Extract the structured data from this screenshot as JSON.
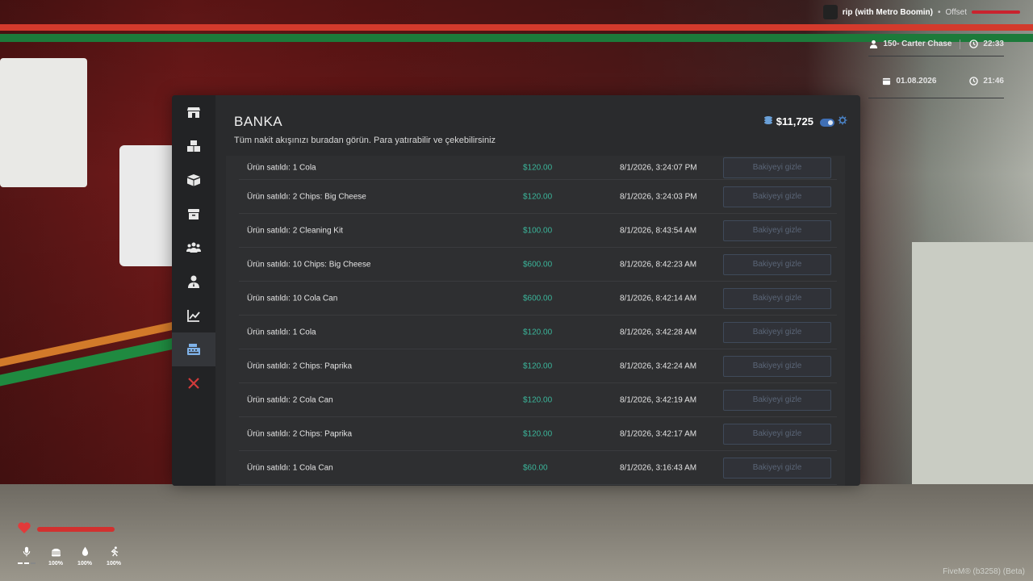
{
  "hud": {
    "music": {
      "track": "rip (with Metro Boomin)",
      "artist": "Offset"
    },
    "player": {
      "id_name": "150- Carter Chase",
      "time": "22:33"
    },
    "game": {
      "date": "01.08.2026",
      "clock": "21:46"
    },
    "vitals": {
      "hunger": "100%",
      "thirst": "100%",
      "stamina": "100%"
    },
    "watermark": "FiveM® (b3258) (Beta)"
  },
  "sidebar": {
    "items": [
      {
        "icon": "store-icon"
      },
      {
        "icon": "boxes-icon"
      },
      {
        "icon": "package-icon"
      },
      {
        "icon": "box-icon"
      },
      {
        "icon": "users-icon"
      },
      {
        "icon": "user-tie-icon"
      },
      {
        "icon": "chart-line-icon"
      },
      {
        "icon": "cash-register-icon",
        "active": true
      },
      {
        "icon": "close-icon"
      }
    ]
  },
  "header": {
    "title": "BANKA",
    "subtitle": "Tüm nakit akışınızı buradan görün. Para yatırabilir ve çekebilirsiniz",
    "balance": "$11,725"
  },
  "transactions": [
    {
      "desc": "Ürün satıldı: 1 Cola",
      "amount": "$120.00",
      "date": "8/1/2026, 3:24:07 PM",
      "action": "Bakiyeyi gizle"
    },
    {
      "desc": "Ürün satıldı: 2 Chips: Big Cheese",
      "amount": "$120.00",
      "date": "8/1/2026, 3:24:03 PM",
      "action": "Bakiyeyi gizle"
    },
    {
      "desc": "Ürün satıldı: 2 Cleaning Kit",
      "amount": "$100.00",
      "date": "8/1/2026, 8:43:54 AM",
      "action": "Bakiyeyi gizle"
    },
    {
      "desc": "Ürün satıldı: 10 Chips: Big Cheese",
      "amount": "$600.00",
      "date": "8/1/2026, 8:42:23 AM",
      "action": "Bakiyeyi gizle"
    },
    {
      "desc": "Ürün satıldı: 10 Cola Can",
      "amount": "$600.00",
      "date": "8/1/2026, 8:42:14 AM",
      "action": "Bakiyeyi gizle"
    },
    {
      "desc": "Ürün satıldı: 1 Cola",
      "amount": "$120.00",
      "date": "8/1/2026, 3:42:28 AM",
      "action": "Bakiyeyi gizle"
    },
    {
      "desc": "Ürün satıldı: 2 Chips: Paprika",
      "amount": "$120.00",
      "date": "8/1/2026, 3:42:24 AM",
      "action": "Bakiyeyi gizle"
    },
    {
      "desc": "Ürün satıldı: 2 Cola Can",
      "amount": "$120.00",
      "date": "8/1/2026, 3:42:19 AM",
      "action": "Bakiyeyi gizle"
    },
    {
      "desc": "Ürün satıldı: 2 Chips: Paprika",
      "amount": "$120.00",
      "date": "8/1/2026, 3:42:17 AM",
      "action": "Bakiyeyi gizle"
    },
    {
      "desc": "Ürün satıldı: 1 Cola Can",
      "amount": "$60.00",
      "date": "8/1/2026, 3:16:43 AM",
      "action": "Bakiyeyi gizle"
    }
  ],
  "colors": {
    "amount": "#3bb59a",
    "accent": "#3f6fb5",
    "close": "#d23b3b"
  }
}
